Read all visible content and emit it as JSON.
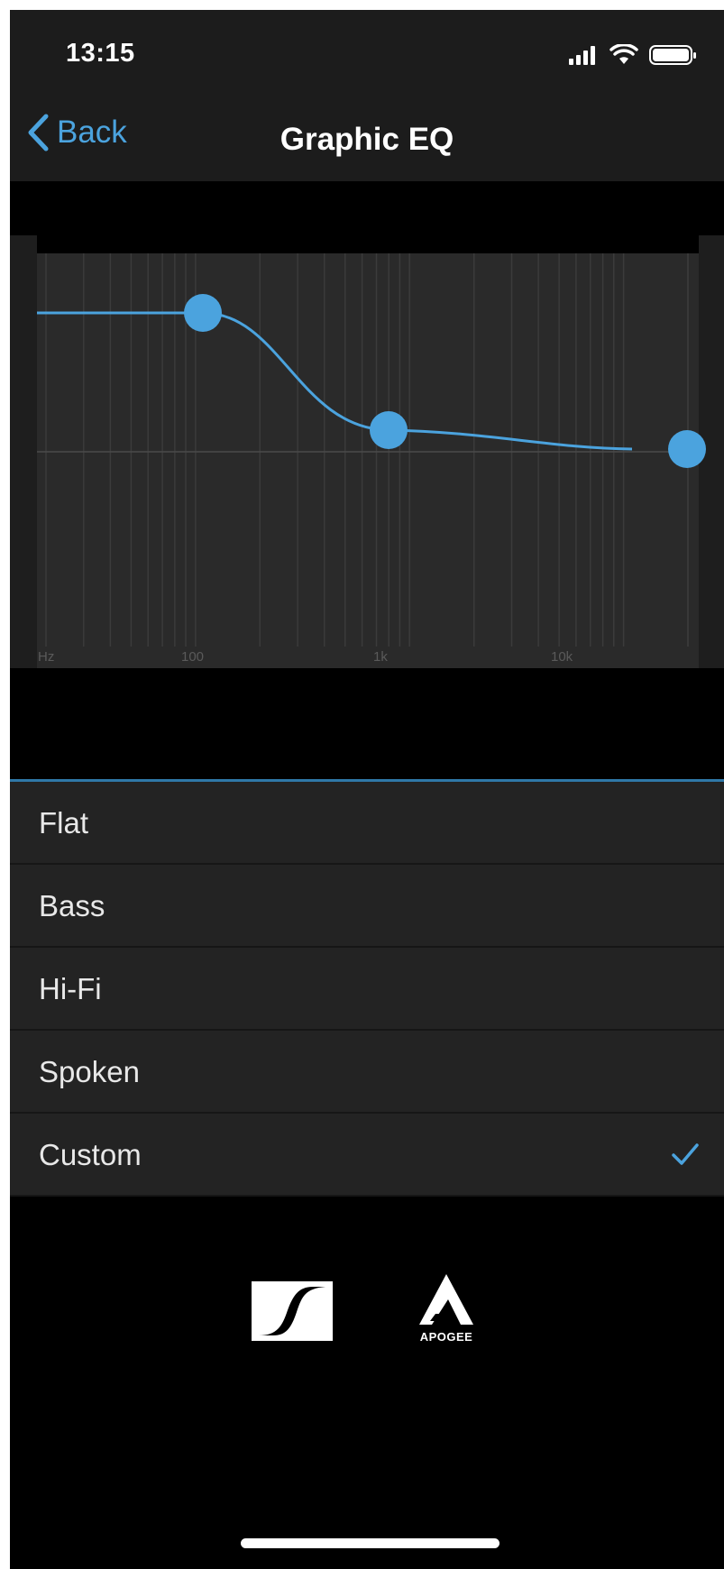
{
  "status_bar": {
    "time": "13:15",
    "icons": [
      "signal-icon",
      "wifi-icon",
      "battery-icon"
    ]
  },
  "nav": {
    "back_label": "Back",
    "title": "Graphic EQ"
  },
  "eq_graph": {
    "frequency_labels": [
      "Hz",
      "100",
      "1k",
      "10k"
    ],
    "curve_color": "#4ba3de",
    "control_points": [
      {
        "name": "low",
        "frequency_hz": 115,
        "gain_level": 0.72
      },
      {
        "name": "mid",
        "frequency_hz": 1200,
        "gain_level": 0.4
      },
      {
        "name": "high",
        "frequency_hz": 18000,
        "gain_level": 0.35
      }
    ]
  },
  "presets": [
    {
      "label": "Flat",
      "selected": false
    },
    {
      "label": "Bass",
      "selected": false
    },
    {
      "label": "Hi-Fi",
      "selected": false
    },
    {
      "label": "Spoken",
      "selected": false
    },
    {
      "label": "Custom",
      "selected": true
    }
  ],
  "logos": {
    "brand_1": "sennheiser-logo",
    "brand_2_text": "APOGEE"
  },
  "colors": {
    "accent": "#4ba3de",
    "background": "#000000",
    "panel": "#1c1c1c",
    "list_row": "#232323"
  }
}
